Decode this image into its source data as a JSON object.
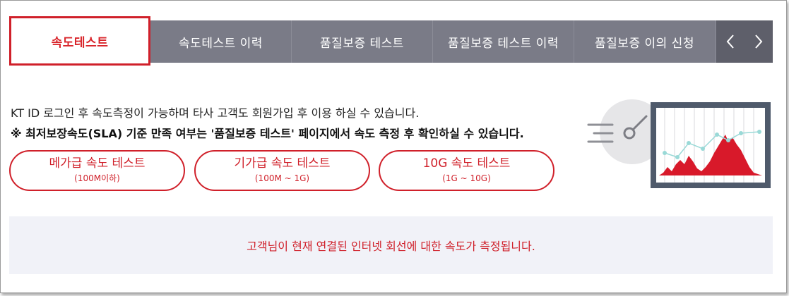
{
  "tabs": [
    {
      "label": "속도테스트",
      "active": true
    },
    {
      "label": "속도테스트 이력",
      "active": false
    },
    {
      "label": "품질보증 테스트",
      "active": false
    },
    {
      "label": "품질보증 테스트 이력",
      "active": false
    },
    {
      "label": "품질보증 이의 신청",
      "active": false
    }
  ],
  "nav": {
    "prev_icon": "chevron-left-icon",
    "next_icon": "chevron-right-icon"
  },
  "info": {
    "line1": "KT ID 로그인 후 속도측정이 가능하며 타사 고객도 회원가입 후 이용 하실 수 있습니다.",
    "line2": "※ 최저보장속도(SLA) 기준 만족 여부는 '품질보증 테스트' 페이지에서 속도 측정 후 확인하실 수 있습니다."
  },
  "tests": [
    {
      "title": "메가급 속도 테스트",
      "range": "(100M이하)"
    },
    {
      "title": "기가급 속도 테스트",
      "range": "(100M ~ 1G)"
    },
    {
      "title": "10G 속도 테스트",
      "range": "(1G ~ 10G)"
    }
  ],
  "banner": {
    "text": "고객님이 현재 연결된 인터넷 회선에 대한 속도가 측정됩니다."
  },
  "colors": {
    "accent": "#d0202a",
    "tab_bg": "#7a7b87",
    "banner_bg": "#f1f2f8"
  }
}
